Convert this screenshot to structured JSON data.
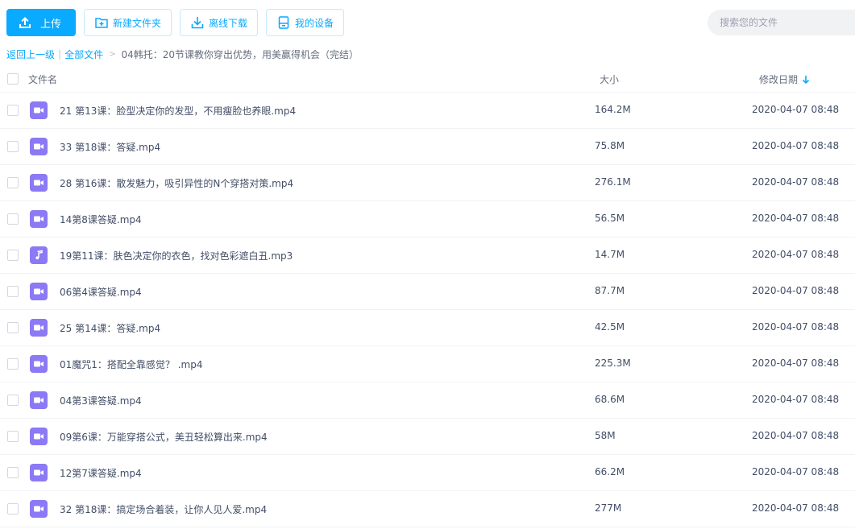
{
  "toolbar": {
    "upload_label": "上传",
    "new_folder_label": "新建文件夹",
    "offline_download_label": "离线下载",
    "my_devices_label": "我的设备"
  },
  "search": {
    "placeholder": "搜索您的文件"
  },
  "breadcrumb": {
    "back_label": "返回上一级",
    "separator": "|",
    "all_files_label": "全部文件",
    "arrow": ">",
    "current": "04韩托：20节课教你穿出优势，用美赢得机会（完结）"
  },
  "table": {
    "col_name": "文件名",
    "col_size": "大小",
    "col_date": "修改日期",
    "rows": [
      {
        "icon": "video-file-icon",
        "name": "21 第13课：脸型决定你的发型，不用瘦脸也养眼.mp4",
        "size": "164.2M",
        "date": "2020-04-07 08:48"
      },
      {
        "icon": "video-file-icon",
        "name": "33 第18课：答疑.mp4",
        "size": "75.8M",
        "date": "2020-04-07 08:48"
      },
      {
        "icon": "video-file-icon",
        "name": "28 第16课：散发魅力，吸引异性的N个穿搭对策.mp4",
        "size": "276.1M",
        "date": "2020-04-07 08:48"
      },
      {
        "icon": "video-file-icon",
        "name": "14第8课答疑.mp4",
        "size": "56.5M",
        "date": "2020-04-07 08:48"
      },
      {
        "icon": "audio-file-icon",
        "name": "19第11课：肤色决定你的衣色，找对色彩遮白丑.mp3",
        "size": "14.7M",
        "date": "2020-04-07 08:48"
      },
      {
        "icon": "video-file-icon",
        "name": "06第4课答疑.mp4",
        "size": "87.7M",
        "date": "2020-04-07 08:48"
      },
      {
        "icon": "video-file-icon",
        "name": "25 第14课：答疑.mp4",
        "size": "42.5M",
        "date": "2020-04-07 08:48"
      },
      {
        "icon": "video-file-icon",
        "name": "01魔咒1：搭配全靠感觉？ .mp4",
        "size": "225.3M",
        "date": "2020-04-07 08:48"
      },
      {
        "icon": "video-file-icon",
        "name": "04第3课答疑.mp4",
        "size": "68.6M",
        "date": "2020-04-07 08:48"
      },
      {
        "icon": "video-file-icon",
        "name": "09第6课：万能穿搭公式，美丑轻松算出来.mp4",
        "size": "58M",
        "date": "2020-04-07 08:48"
      },
      {
        "icon": "video-file-icon",
        "name": "12第7课答疑.mp4",
        "size": "66.2M",
        "date": "2020-04-07 08:48"
      },
      {
        "icon": "video-file-icon",
        "name": "32 第18课：搞定场合着装，让你人见人爱.mp4",
        "size": "277M",
        "date": "2020-04-07 08:48"
      }
    ]
  },
  "colors": {
    "accent": "#09aaff",
    "file_icon": "#8b79f5",
    "text": "#424e67"
  }
}
